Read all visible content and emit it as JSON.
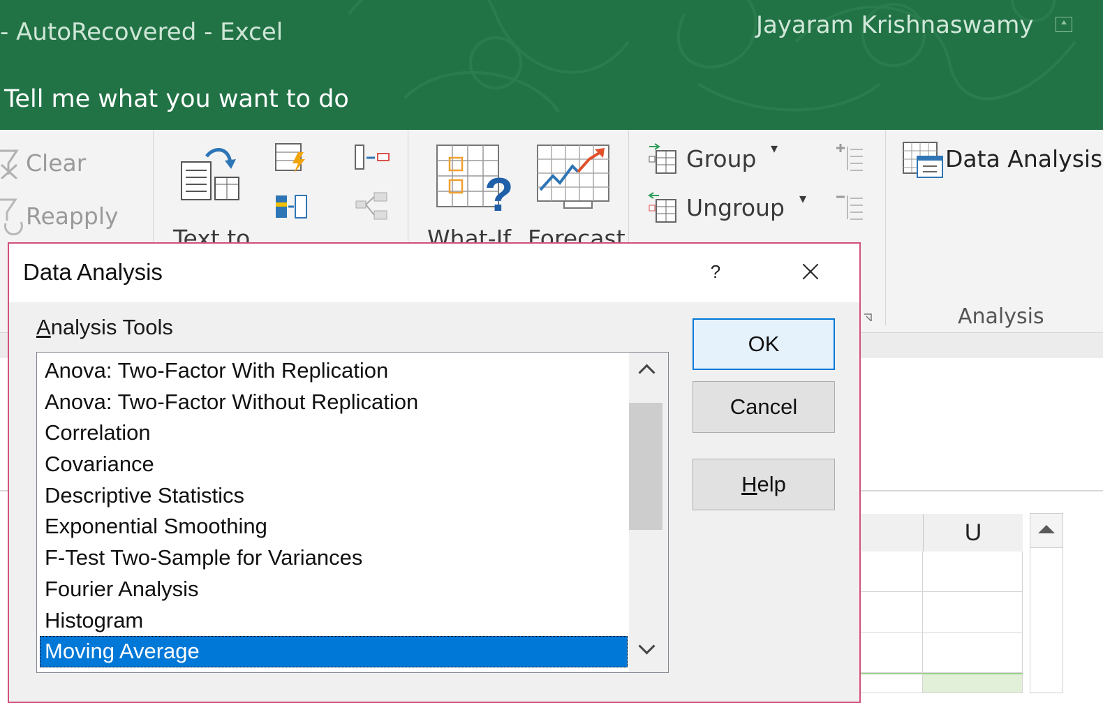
{
  "window": {
    "title": "-  AutoRecovered  -  Excel",
    "user": "Jayaram Krishnaswamy",
    "tell_me": "Tell me what you want to do"
  },
  "ribbon": {
    "sort_filter": {
      "clear": "Clear",
      "reapply": "Reapply"
    },
    "data_tools": {
      "text_to": "Text to"
    },
    "forecast": {
      "what_if": "What-If",
      "forecast": "Forecast"
    },
    "outline": {
      "group": "Group",
      "ungroup": "Ungroup"
    },
    "analysis": {
      "data_analysis": "Data Analysis",
      "group_label": "Analysis"
    }
  },
  "sheet": {
    "column_u": "U"
  },
  "dialog": {
    "title": "Data Analysis",
    "help_glyph": "?",
    "tools_label_accel": "A",
    "tools_label_rest": "nalysis Tools",
    "tools": [
      "Anova: Two-Factor With Replication",
      "Anova: Two-Factor Without Replication",
      "Correlation",
      "Covariance",
      "Descriptive Statistics",
      "Exponential Smoothing",
      "F-Test Two-Sample for Variances",
      "Fourier Analysis",
      "Histogram",
      "Moving Average"
    ],
    "selected_tool": "Moving Average",
    "ok": "OK",
    "cancel": "Cancel",
    "help_accel": "H",
    "help_rest": "elp"
  },
  "colors": {
    "excel_green": "#217346",
    "dialog_border": "#d1507a",
    "selection": "#0078d7"
  }
}
